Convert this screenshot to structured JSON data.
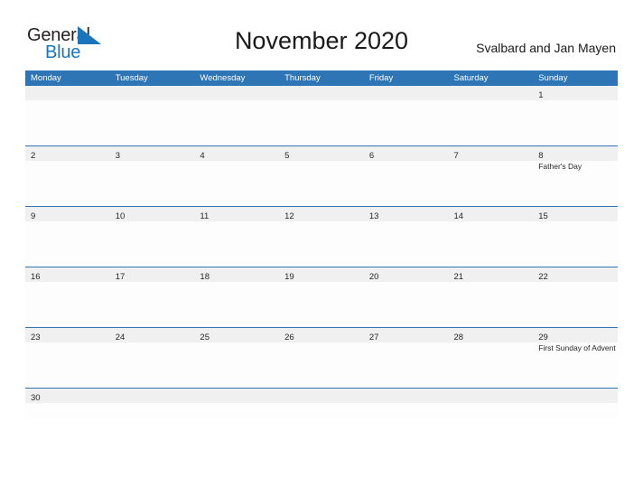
{
  "brand": {
    "word_one": "General",
    "word_two": "Blue",
    "mark": "triangle-flag-icon",
    "color_dark": "#231f20",
    "color_blue": "#1b75bc"
  },
  "header": {
    "title": "November 2020",
    "region": "Svalbard and Jan Mayen"
  },
  "theme": {
    "header_blue": "#2e75b6",
    "date_band_gray": "#f0f0f0",
    "row_rule_blue": "#2e75b6",
    "text_dark": "#262626"
  },
  "calendar": {
    "weekdays": [
      "Monday",
      "Tuesday",
      "Wednesday",
      "Thursday",
      "Friday",
      "Saturday",
      "Sunday"
    ],
    "weeks": [
      [
        {
          "date": "",
          "event": ""
        },
        {
          "date": "",
          "event": ""
        },
        {
          "date": "",
          "event": ""
        },
        {
          "date": "",
          "event": ""
        },
        {
          "date": "",
          "event": ""
        },
        {
          "date": "",
          "event": ""
        },
        {
          "date": "1",
          "event": ""
        }
      ],
      [
        {
          "date": "2",
          "event": ""
        },
        {
          "date": "3",
          "event": ""
        },
        {
          "date": "4",
          "event": ""
        },
        {
          "date": "5",
          "event": ""
        },
        {
          "date": "6",
          "event": ""
        },
        {
          "date": "7",
          "event": ""
        },
        {
          "date": "8",
          "event": "Father's Day"
        }
      ],
      [
        {
          "date": "9",
          "event": ""
        },
        {
          "date": "10",
          "event": ""
        },
        {
          "date": "11",
          "event": ""
        },
        {
          "date": "12",
          "event": ""
        },
        {
          "date": "13",
          "event": ""
        },
        {
          "date": "14",
          "event": ""
        },
        {
          "date": "15",
          "event": ""
        }
      ],
      [
        {
          "date": "16",
          "event": ""
        },
        {
          "date": "17",
          "event": ""
        },
        {
          "date": "18",
          "event": ""
        },
        {
          "date": "19",
          "event": ""
        },
        {
          "date": "20",
          "event": ""
        },
        {
          "date": "21",
          "event": ""
        },
        {
          "date": "22",
          "event": ""
        }
      ],
      [
        {
          "date": "23",
          "event": ""
        },
        {
          "date": "24",
          "event": ""
        },
        {
          "date": "25",
          "event": ""
        },
        {
          "date": "26",
          "event": ""
        },
        {
          "date": "27",
          "event": ""
        },
        {
          "date": "28",
          "event": ""
        },
        {
          "date": "29",
          "event": "First Sunday of Advent"
        }
      ],
      [
        {
          "date": "30",
          "event": ""
        },
        {
          "date": "",
          "event": ""
        },
        {
          "date": "",
          "event": ""
        },
        {
          "date": "",
          "event": ""
        },
        {
          "date": "",
          "event": ""
        },
        {
          "date": "",
          "event": ""
        },
        {
          "date": "",
          "event": ""
        }
      ]
    ]
  }
}
